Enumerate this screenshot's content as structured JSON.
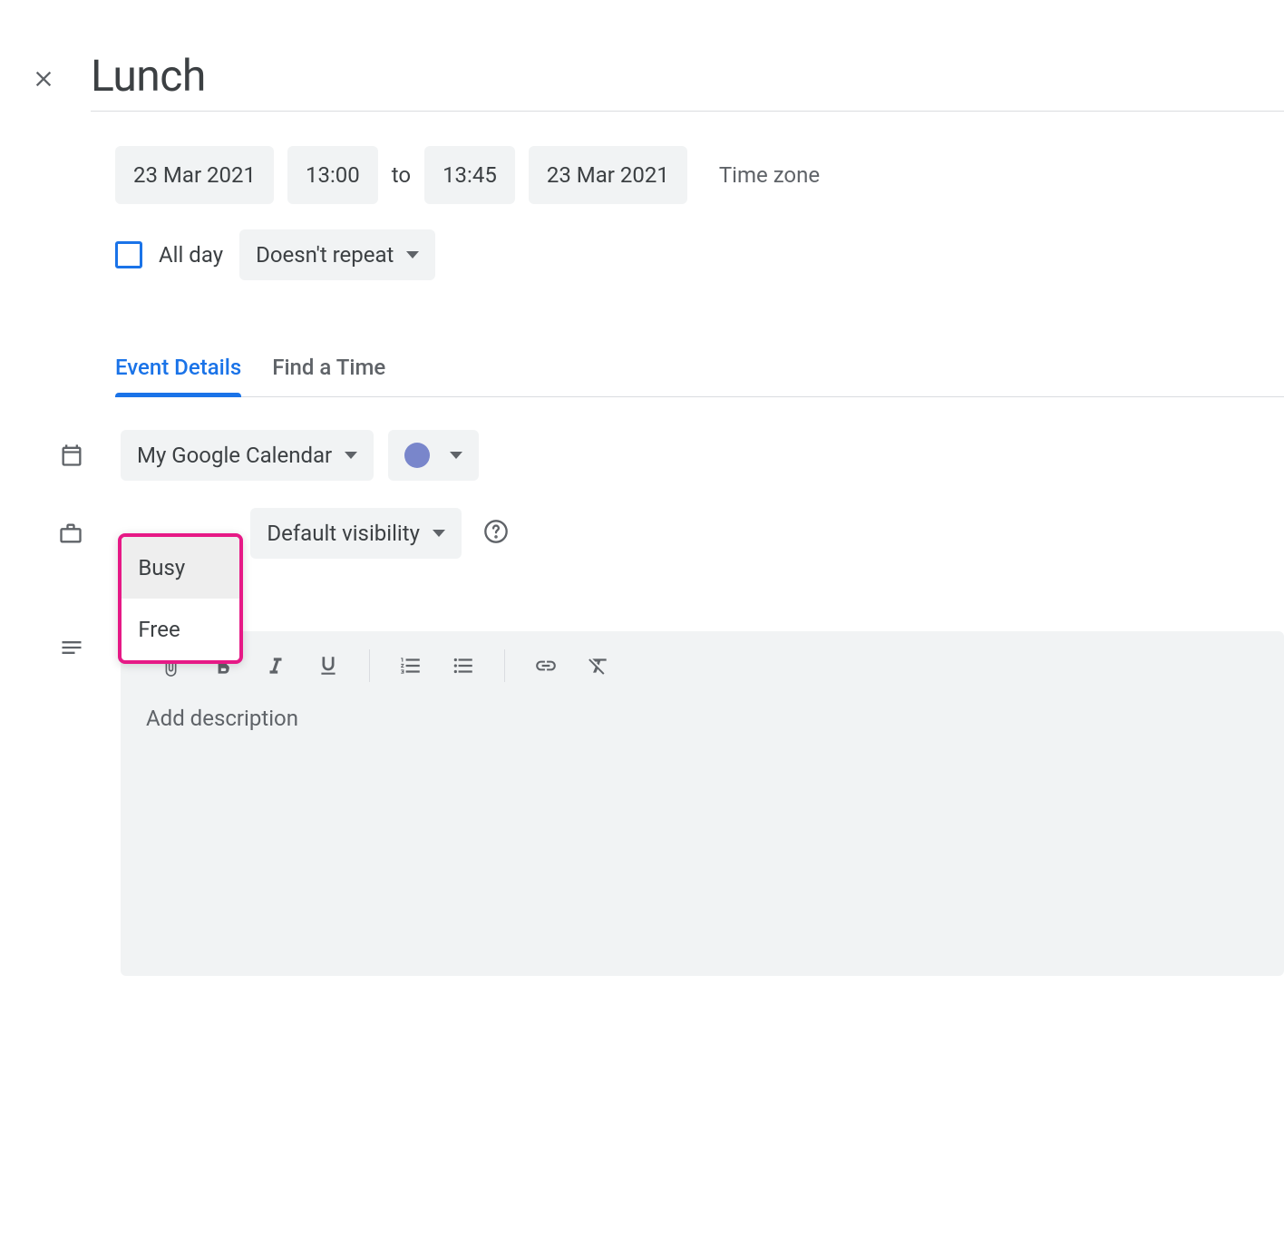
{
  "event": {
    "title": "Lunch",
    "start_date": "23 Mar 2021",
    "start_time": "13:00",
    "to_label": "to",
    "end_time": "13:45",
    "end_date": "23 Mar 2021",
    "timezone_label": "Time zone",
    "all_day_label": "All day",
    "recurrence": "Doesn't repeat"
  },
  "tabs": {
    "details": "Event Details",
    "find_time": "Find a Time"
  },
  "details": {
    "calendar": "My Google Calendar",
    "visibility": "Default visibility",
    "description_placeholder": "Add description"
  },
  "status_menu": {
    "busy": "Busy",
    "free": "Free"
  }
}
